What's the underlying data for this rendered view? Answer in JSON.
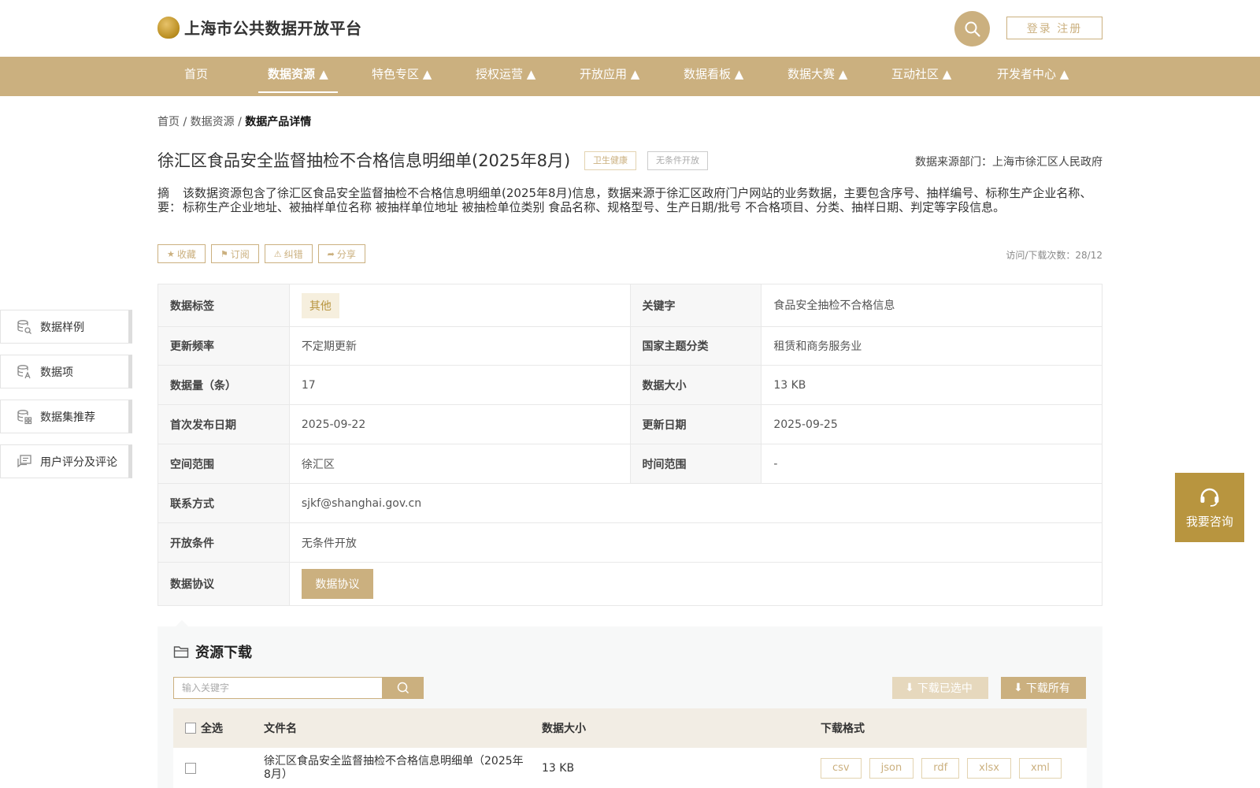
{
  "header": {
    "site_title": "上海市公共数据开放平台",
    "login_label": "登录 注册"
  },
  "nav": {
    "items": [
      {
        "label": "首页"
      },
      {
        "label": "数据资源 ▲"
      },
      {
        "label": "特色专区 ▲"
      },
      {
        "label": "授权运营 ▲"
      },
      {
        "label": "开放应用 ▲"
      },
      {
        "label": "数据看板 ▲"
      },
      {
        "label": "数据大赛 ▲"
      },
      {
        "label": "互动社区 ▲"
      },
      {
        "label": "开发者中心 ▲"
      }
    ],
    "active_index": 1
  },
  "breadcrumb": {
    "home": "首页",
    "sep1": " / ",
    "resources": "数据资源",
    "sep2": " / ",
    "current": "数据产品详情"
  },
  "dataset": {
    "title": "徐汇区食品安全监督抽检不合格信息明细单(2025年8月)",
    "tag_category": "卫生健康",
    "tag_open": "无条件开放",
    "source": "数据来源部门：上海市徐汇区人民政府",
    "abstract_label": "摘要：",
    "abstract_text": "该数据资源包含了徐汇区食品安全监督抽检不合格信息明细单(2025年8月)信息，数据来源于徐汇区政府门户网站的业务数据，主要包含序号、抽样编号、标称生产企业名称、标称生产企业地址、被抽样单位名称 被抽样单位地址 被抽检单位类别 食品名称、规格型号、生产日期/批号 不合格项目、分类、抽样日期、判定等字段信息。",
    "visits": "访问/下载次数：28/12"
  },
  "actions": {
    "favorite": "收藏",
    "subscribe": "订阅",
    "correct": "纠错",
    "share": "分享"
  },
  "side_menu": {
    "items": [
      {
        "label": "数据样例",
        "icon": "database-search-icon"
      },
      {
        "label": "数据项",
        "icon": "database-text-icon"
      },
      {
        "label": "数据集推荐",
        "icon": "database-grid-icon"
      },
      {
        "label": "用户评分及评论",
        "icon": "comment-icon"
      }
    ]
  },
  "info": {
    "tag_key": "数据标签",
    "tag_val": "其他",
    "keyword_key": "关键字",
    "keyword_val": "食品安全抽检不合格信息",
    "freq_key": "更新频率",
    "freq_val": "不定期更新",
    "theme_key": "国家主题分类",
    "theme_val": "租赁和商务服务业",
    "count_key": "数据量（条）",
    "count_val": "17",
    "size_key": "数据大小",
    "size_val": "13 KB",
    "first_key": "首次发布日期",
    "first_val": "2025-09-22",
    "update_key": "更新日期",
    "update_val": "2025-09-25",
    "space_key": "空间范围",
    "space_val": "徐汇区",
    "time_key": "时间范围",
    "time_val": "-",
    "contact_key": "联系方式",
    "contact_val": "sjkf@shanghai.gov.cn",
    "cond_key": "开放条件",
    "cond_val": "无条件开放",
    "agree_key": "数据协议",
    "agree_btn": "数据协议"
  },
  "download": {
    "title": "资源下载",
    "search_placeholder": "输入关键字",
    "download_selected": "下载已选中",
    "download_all": "下载所有",
    "columns": {
      "select_all": "全选",
      "filename": "文件名",
      "size": "数据大小",
      "format": "下载格式"
    },
    "rows": [
      {
        "filename": "徐汇区食品安全监督抽检不合格信息明细单（2025年8月）",
        "size": "13 KB",
        "formats": [
          "csv",
          "json",
          "rdf",
          "xlsx",
          "xml"
        ]
      }
    ]
  },
  "consult": {
    "label": "我要咨询"
  },
  "colors": {
    "brand": "#cbb07f",
    "brand_dark": "#b8953f"
  }
}
